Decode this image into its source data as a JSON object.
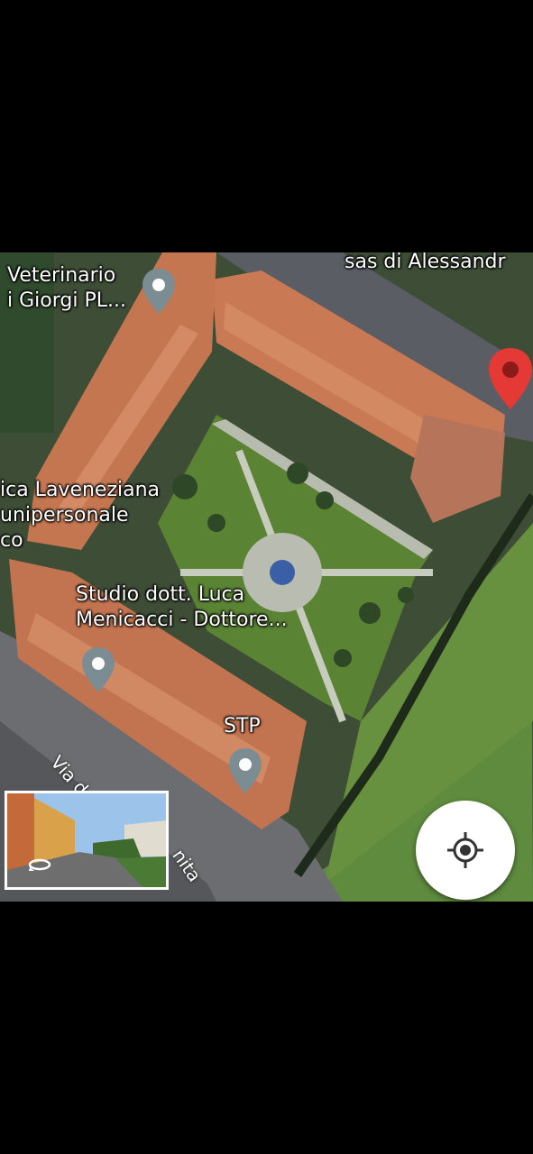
{
  "labels": {
    "vet_line1": "Veterinario",
    "vet_line2": "i Giorgi PL...",
    "sas": "sas di Alessandr",
    "lav_line1": "ica Laveneziana",
    "lav_line2": "unipersonale",
    "lav_line3": "co",
    "studio_line1": "Studio dott. Luca",
    "studio_line2": "Menicacci - Dottore...",
    "stp": "STP",
    "street_a": "Via d",
    "street_b": "nita"
  },
  "colors": {
    "red_pin": "#e53935",
    "gray_pin": "#7b8c93",
    "locate_icon": "#333333"
  },
  "icons": {
    "streetview": "rotate-360-icon",
    "locate": "my-location-icon"
  }
}
